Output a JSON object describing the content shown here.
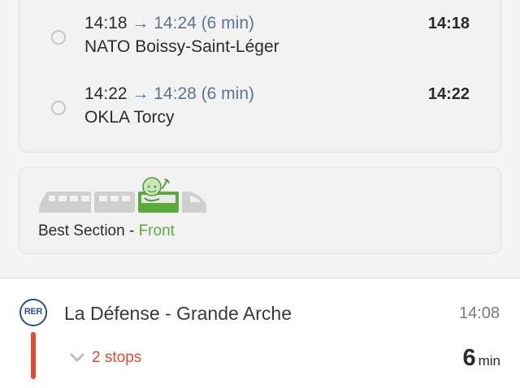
{
  "departures": [
    {
      "dep_time": "14:18",
      "arrow": "→",
      "arr_time": "14:24",
      "duration": "(6 min)",
      "name": "NATO Boissy-Saint-Léger",
      "right_time": "14:18"
    },
    {
      "dep_time": "14:22",
      "arrow": "→",
      "arr_time": "14:28",
      "duration": "(6 min)",
      "name": "OKLA Torcy",
      "right_time": "14:22"
    }
  ],
  "best_section": {
    "label": "Best Section - ",
    "value": "Front"
  },
  "station": {
    "line_badge": "RER",
    "name": "La Défense - Grande Arche",
    "time": "14:08",
    "stops": "2 stops",
    "duration_num": "6",
    "duration_unit": "min"
  },
  "colors": {
    "accent_green": "#5aab3a",
    "line_red": "#e24b32",
    "rer_blue": "#2b4f94",
    "time_blue": "#5d7591"
  },
  "icons": {
    "radio": "radio-button-icon",
    "train": "train-car-icon",
    "chevron": "chevron-down-icon"
  }
}
